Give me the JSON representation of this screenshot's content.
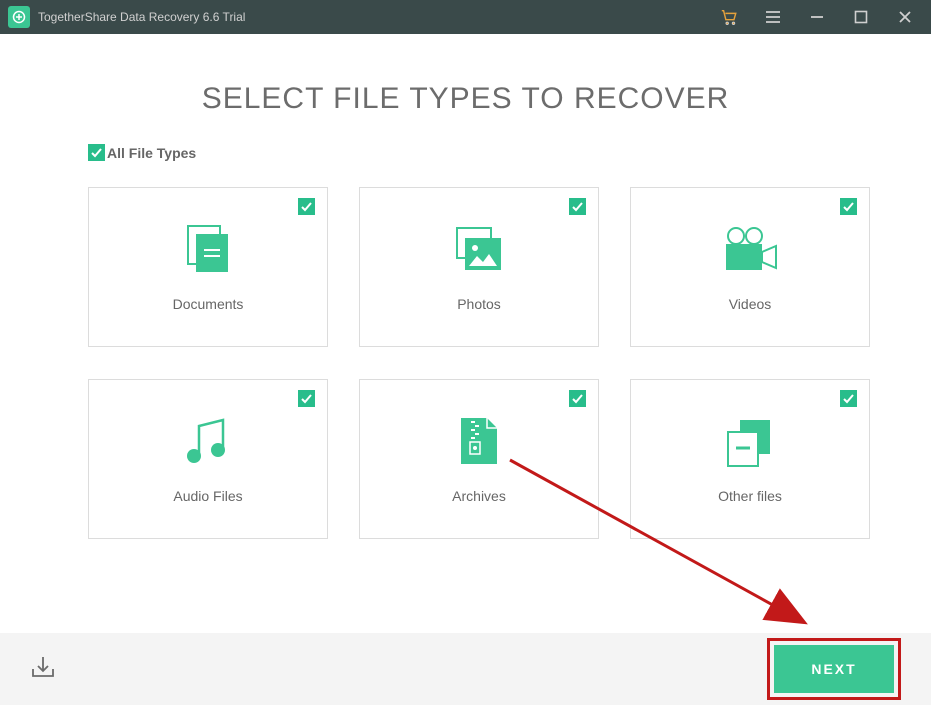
{
  "titlebar": {
    "title": "TogetherShare Data Recovery 6.6 Trial"
  },
  "heading": "SELECT FILE TYPES TO RECOVER",
  "allTypes": {
    "label": "All File Types",
    "checked": true
  },
  "tiles": [
    {
      "id": "documents",
      "label": "Documents",
      "icon": "documents-icon",
      "checked": true
    },
    {
      "id": "photos",
      "label": "Photos",
      "icon": "photos-icon",
      "checked": true
    },
    {
      "id": "videos",
      "label": "Videos",
      "icon": "videos-icon",
      "checked": true
    },
    {
      "id": "audio",
      "label": "Audio Files",
      "icon": "audio-icon",
      "checked": true
    },
    {
      "id": "archives",
      "label": "Archives",
      "icon": "archives-icon",
      "checked": true
    },
    {
      "id": "other",
      "label": "Other files",
      "icon": "other-icon",
      "checked": true
    }
  ],
  "footer": {
    "next_label": "NEXT"
  },
  "colors": {
    "accent": "#3bc693",
    "check": "#28bd8b",
    "annotation": "#c21919"
  }
}
